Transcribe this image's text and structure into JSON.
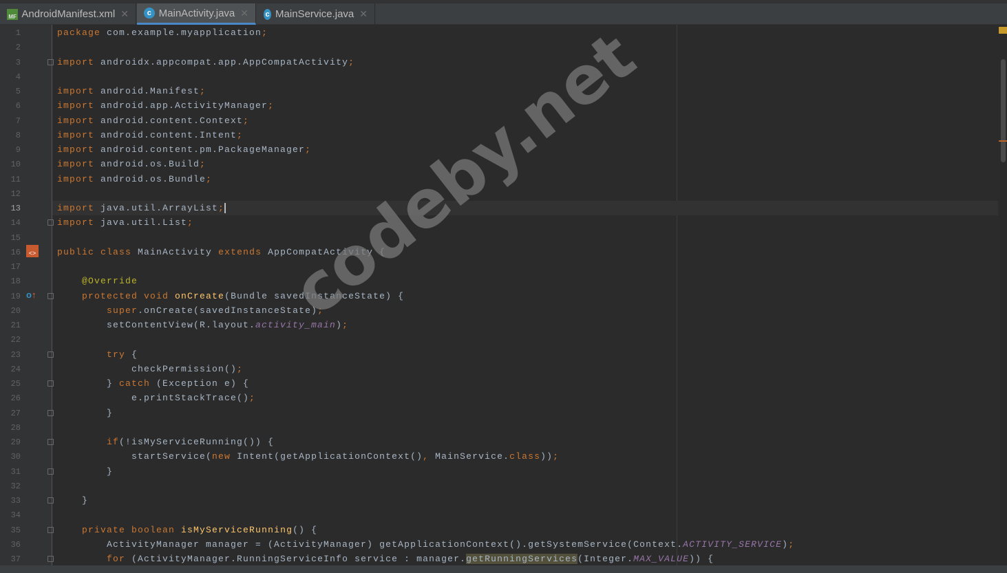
{
  "tabs": [
    {
      "label": "AndroidManifest.xml",
      "icon": "manifest-icon",
      "active": false
    },
    {
      "label": "MainActivity.java",
      "icon": "class-icon",
      "active": true
    },
    {
      "label": "MainService.java",
      "icon": "class-icon",
      "active": false
    }
  ],
  "watermark": "codeby.net",
  "current_line": 13,
  "colors": {
    "keyword": "#cc7832",
    "text": "#a9b7c6",
    "function": "#ffc66d",
    "annotation": "#bbb529",
    "constant": "#9876aa",
    "accent": "#4a88c7"
  },
  "fold_lines": [
    3,
    14,
    19,
    23,
    25,
    27,
    29,
    31,
    33,
    35,
    37
  ],
  "code": [
    [
      [
        "kw",
        "package "
      ],
      [
        "",
        "com.example.myapplication"
      ],
      [
        "kw",
        ";"
      ]
    ],
    [],
    [
      [
        "kw",
        "import "
      ],
      [
        "",
        "androidx.appcompat.app.AppCompatActivity"
      ],
      [
        "kw",
        ";"
      ]
    ],
    [],
    [
      [
        "kw",
        "import "
      ],
      [
        "",
        "android.Manifest"
      ],
      [
        "kw",
        ";"
      ]
    ],
    [
      [
        "kw",
        "import "
      ],
      [
        "",
        "android.app.ActivityManager"
      ],
      [
        "kw",
        ";"
      ]
    ],
    [
      [
        "kw",
        "import "
      ],
      [
        "",
        "android.content.Context"
      ],
      [
        "kw",
        ";"
      ]
    ],
    [
      [
        "kw",
        "import "
      ],
      [
        "",
        "android.content.Intent"
      ],
      [
        "kw",
        ";"
      ]
    ],
    [
      [
        "kw",
        "import "
      ],
      [
        "",
        "android.content.pm.PackageManager"
      ],
      [
        "kw",
        ";"
      ]
    ],
    [
      [
        "kw",
        "import "
      ],
      [
        "",
        "android.os.Build"
      ],
      [
        "kw",
        ";"
      ]
    ],
    [
      [
        "kw",
        "import "
      ],
      [
        "",
        "android.os.Bundle"
      ],
      [
        "kw",
        ";"
      ]
    ],
    [],
    [
      [
        "kw",
        "import "
      ],
      [
        "",
        "java.util.ArrayList"
      ],
      [
        "kw",
        ";"
      ]
    ],
    [
      [
        "kw",
        "import "
      ],
      [
        "",
        "java.util.List"
      ],
      [
        "kw",
        ";"
      ]
    ],
    [],
    [
      [
        "kw",
        "public class "
      ],
      [
        "",
        "MainActivity "
      ],
      [
        "kw",
        "extends "
      ],
      [
        "",
        "AppCompatActivity {"
      ]
    ],
    [],
    [
      [
        "",
        "    "
      ],
      [
        "ann",
        "@Override"
      ]
    ],
    [
      [
        "",
        "    "
      ],
      [
        "kw",
        "protected void "
      ],
      [
        "fn",
        "onCreate"
      ],
      [
        "",
        "(Bundle savedInstanceState) {"
      ]
    ],
    [
      [
        "",
        "        "
      ],
      [
        "kw",
        "super"
      ],
      [
        "",
        ".onCreate(savedInstanceState)"
      ],
      [
        "kw",
        ";"
      ]
    ],
    [
      [
        "",
        "        setContentView(R.layout."
      ],
      [
        "cst",
        "activity_main"
      ],
      [
        "",
        ")"
      ],
      [
        "kw",
        ";"
      ]
    ],
    [],
    [
      [
        "",
        "        "
      ],
      [
        "kw",
        "try "
      ],
      [
        "",
        "{"
      ]
    ],
    [
      [
        "",
        "            checkPermission()"
      ],
      [
        "kw",
        ";"
      ]
    ],
    [
      [
        "",
        "        } "
      ],
      [
        "kw",
        "catch "
      ],
      [
        "",
        "(Exception e) {"
      ]
    ],
    [
      [
        "",
        "            e.printStackTrace()"
      ],
      [
        "kw",
        ";"
      ]
    ],
    [
      [
        "",
        "        }"
      ]
    ],
    [],
    [
      [
        "",
        "        "
      ],
      [
        "kw",
        "if"
      ],
      [
        "",
        "(!isMyServiceRunning()) {"
      ]
    ],
    [
      [
        "",
        "            startService("
      ],
      [
        "kw",
        "new "
      ],
      [
        "",
        "Intent(getApplicationContext()"
      ],
      [
        "kw",
        ", "
      ],
      [
        "",
        "MainService."
      ],
      [
        "kw",
        "class"
      ],
      [
        "",
        "))"
      ],
      [
        "kw",
        ";"
      ]
    ],
    [
      [
        "",
        "        }"
      ]
    ],
    [],
    [
      [
        "",
        "    }"
      ]
    ],
    [],
    [
      [
        "",
        "    "
      ],
      [
        "kw",
        "private boolean "
      ],
      [
        "fn",
        "isMyServiceRunning"
      ],
      [
        "",
        "() {"
      ]
    ],
    [
      [
        "",
        "        ActivityManager manager = (ActivityManager) getApplicationContext().getSystemService(Context."
      ],
      [
        "cst",
        "ACTIVITY_SERVICE"
      ],
      [
        "",
        ")"
      ],
      [
        "kw",
        ";"
      ]
    ],
    [
      [
        "",
        "        "
      ],
      [
        "kw",
        "for "
      ],
      [
        "",
        "(ActivityManager.RunningServiceInfo service : manager."
      ],
      [
        "hl",
        "getRunningServices"
      ],
      [
        "",
        "(Integer."
      ],
      [
        "cst",
        "MAX_VALUE"
      ],
      [
        "",
        ")) {"
      ]
    ]
  ]
}
